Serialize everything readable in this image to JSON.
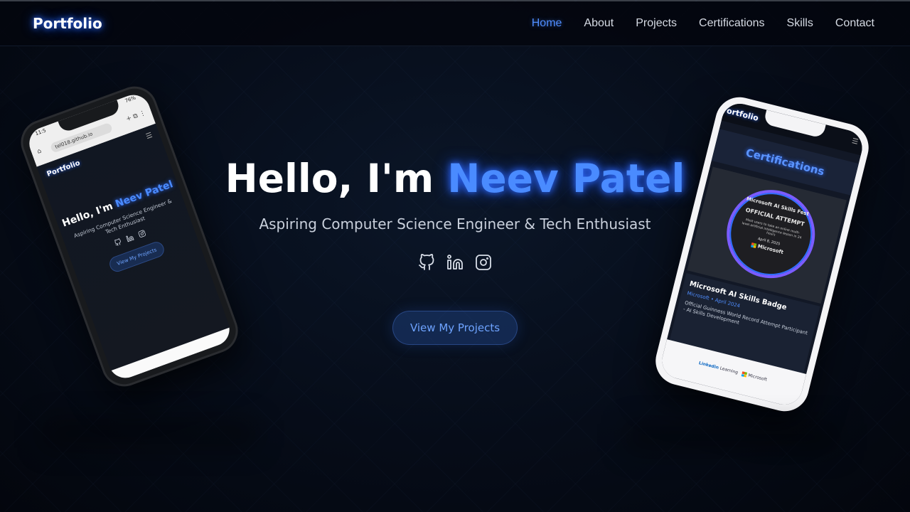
{
  "navbar": {
    "brand": "Portfolio",
    "links": [
      {
        "label": "Home",
        "active": true
      },
      {
        "label": "About",
        "active": false
      },
      {
        "label": "Projects",
        "active": false
      },
      {
        "label": "Certifications",
        "active": false
      },
      {
        "label": "Skills",
        "active": false
      },
      {
        "label": "Contact",
        "active": false
      }
    ]
  },
  "hero": {
    "greeting": "Hello, I'm ",
    "name": "Neev Patel",
    "subtitle": "Aspiring Computer Science Engineer & Tech Enthusiast",
    "socials": [
      "github-icon",
      "linkedin-icon",
      "instagram-icon"
    ],
    "cta_label": "View My Projects"
  },
  "phone_left": {
    "status_time": "11:5",
    "status_battery": "76%",
    "url": "tel018.github.io",
    "brand": "Portfolio",
    "greeting": "Hello, I'm ",
    "name": "Neev Patel",
    "subtitle": "Aspiring Computer Science Engineer & Tech Enthusiast",
    "cta_label": "View My Projects"
  },
  "phone_right": {
    "brand": "ortfolio",
    "section_title": "Certifications",
    "badge": {
      "ring_text": "Microsoft AI Skills Fest",
      "official": "OFFICIAL ATTEMPT",
      "desc": "Most users to take an online multi-level artificial intelligence lesson in 24 hours",
      "date": "April 8, 2025",
      "brand": "Microsoft"
    },
    "cert_title": "Microsoft AI Skills Badge",
    "cert_meta": "Microsoft • April 2024",
    "cert_desc": "Official Guinness World Record Attempt Participant - AI Skills Development",
    "footer_linkedin": "Linked",
    "footer_in": "in",
    "footer_learning": "Learning",
    "footer_ms": "Microsoft"
  },
  "colors": {
    "accent": "#4a8bff",
    "background": "#060c18"
  }
}
